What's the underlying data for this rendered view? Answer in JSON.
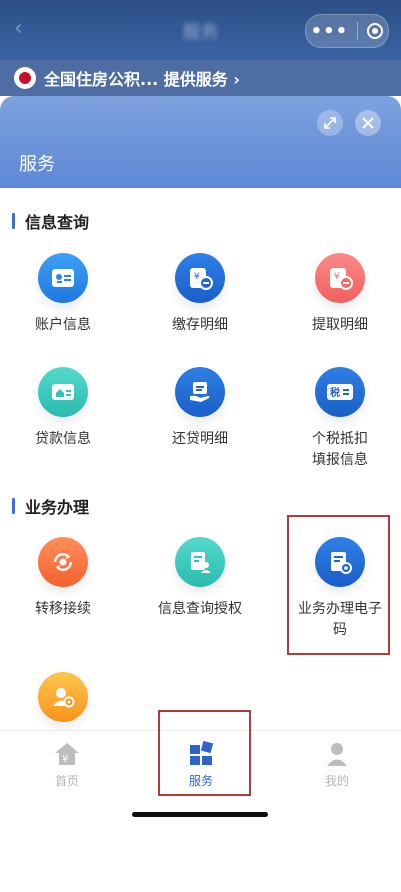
{
  "navbar": {
    "title": "服务",
    "back": "‹"
  },
  "provider": {
    "text": "全国住房公积... 提供服务 ›"
  },
  "sheet": {
    "title": "服务"
  },
  "sections": [
    {
      "title": "信息查询",
      "items": [
        {
          "label": "账户信息",
          "icon": "id-card-icon"
        },
        {
          "label": "缴存明细",
          "icon": "deposit-icon"
        },
        {
          "label": "提取明细",
          "icon": "withdraw-icon"
        },
        {
          "label": "贷款信息",
          "icon": "loan-icon"
        },
        {
          "label": "还贷明细",
          "icon": "repay-icon"
        },
        {
          "label": "个税抵扣\n填报信息",
          "icon": "tax-icon",
          "glyph": "税"
        }
      ]
    },
    {
      "title": "业务办理",
      "items": [
        {
          "label": "转移接续",
          "icon": "transfer-icon"
        },
        {
          "label": "信息查询授权",
          "icon": "authorize-icon"
        },
        {
          "label": "业务办理电子\n码",
          "icon": "ecode-icon"
        },
        {
          "label": "",
          "icon": "user-settings-icon"
        }
      ]
    }
  ],
  "tabbar": [
    {
      "label": "首页",
      "icon": "home-icon",
      "active": false
    },
    {
      "label": "服务",
      "icon": "grid-icon",
      "active": true
    },
    {
      "label": "我的",
      "icon": "profile-icon",
      "active": false
    }
  ],
  "colors": {
    "accent": "#3b6fd6",
    "active_tab": "#2f63c9",
    "inactive_tab": "#b5b5b5",
    "highlight": "#b23a3a"
  }
}
